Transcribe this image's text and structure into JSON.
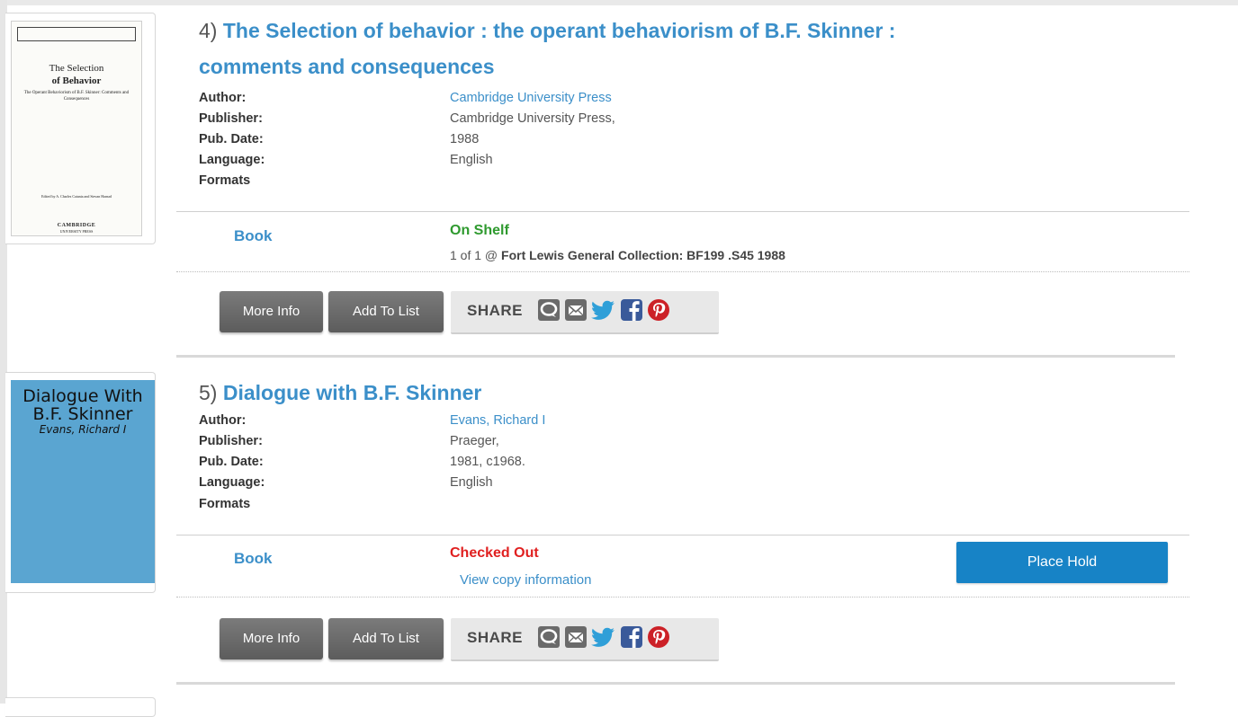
{
  "results": [
    {
      "number": "4)",
      "title_line1": "The Selection of behavior : the operant behaviorism of B.F. Skinner :",
      "title_line2": "comments and consequences",
      "labels": {
        "author": "Author:",
        "publisher": "Publisher:",
        "pub_date": "Pub. Date:",
        "language": "Language:",
        "formats": "Formats"
      },
      "author": "Cambridge University Press",
      "publisher": "Cambridge University Press,",
      "pub_date": "1988",
      "language": "English",
      "cover": {
        "title_line1": "The Selection",
        "title_line2": "of Behavior",
        "subtitle": "The Operant Behaviorism of B.F. Skinner: Comments and Consequences",
        "editors": "Edited by A. Charles Catania and Stevan Harnad",
        "publisher": "CAMBRIDGE",
        "publisher_sub": "UNIVERSITY PRESS"
      },
      "format": "Book",
      "status": "On Shelf",
      "holdings_prefix": "1 of 1 @ ",
      "holdings_location": "Fort Lewis General Collection: BF199 .S45 1988",
      "buttons": {
        "more_info": "More Info",
        "add_to_list": "Add To List",
        "share": "SHARE"
      }
    },
    {
      "number": "5)",
      "title_line1": "Dialogue with B.F. Skinner",
      "labels": {
        "author": "Author:",
        "publisher": "Publisher:",
        "pub_date": "Pub. Date:",
        "language": "Language:",
        "formats": "Formats"
      },
      "author": "Evans, Richard I",
      "publisher": "Praeger,",
      "pub_date": "1981, c1968.",
      "language": "English",
      "cover": {
        "title_line1": "Dialogue With",
        "title_line2": "B.F. Skinner",
        "author": "Evans, Richard I",
        "color": "#5aa5d1"
      },
      "format": "Book",
      "status": "Checked Out",
      "view_copy": "View copy information",
      "place_hold": "Place Hold",
      "buttons": {
        "more_info": "More Info",
        "add_to_list": "Add To List",
        "share": "SHARE"
      }
    }
  ],
  "colors": {
    "link": "#3b8fc9",
    "on_shelf": "#2f9a2f",
    "checked_out": "#e02020",
    "place_hold": "#1783c6",
    "button": "#6a6a6a"
  },
  "share_icons": [
    "comment-icon",
    "email-icon",
    "twitter-icon",
    "facebook-icon",
    "pinterest-icon"
  ]
}
